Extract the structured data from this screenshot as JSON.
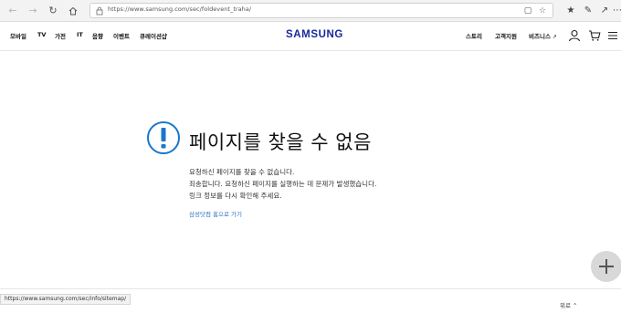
{
  "browser": {
    "url": "https://www.samsung.com/sec/foldevent_traha/",
    "back_icon": "back-arrow-icon",
    "forward_icon": "forward-arrow-icon",
    "refresh_icon": "refresh-icon",
    "home_icon": "home-icon"
  },
  "header": {
    "nav": [
      {
        "label": "모바일"
      },
      {
        "label": "TV"
      },
      {
        "label": "가전"
      },
      {
        "label": "IT"
      },
      {
        "label": "음향"
      },
      {
        "label": "이벤트"
      },
      {
        "label": "큐레이션샵"
      }
    ],
    "logo": "SAMSUNG",
    "util": {
      "story": "스토리",
      "support": "고객지원",
      "business": "비즈니스"
    }
  },
  "error": {
    "title": "페이지를 찾을 수 없음",
    "line1": "요청하신 페이지를 찾을 수 없습니다.",
    "line2": "죄송합니다. 요청하신 페이지를 실행하는 데 문제가 발생했습니다.",
    "line3": "링크 정보를 다시 확인해 주세요.",
    "home_link": "삼성닷컴 홈으로 가기"
  },
  "footer": {
    "status_url": "https://www.samsung.com/sec/info/sitemap/",
    "top_label": "위로"
  },
  "colors": {
    "brand": "#1428a0",
    "error_icon": "#1a77c9",
    "link": "#2a6ec4"
  }
}
